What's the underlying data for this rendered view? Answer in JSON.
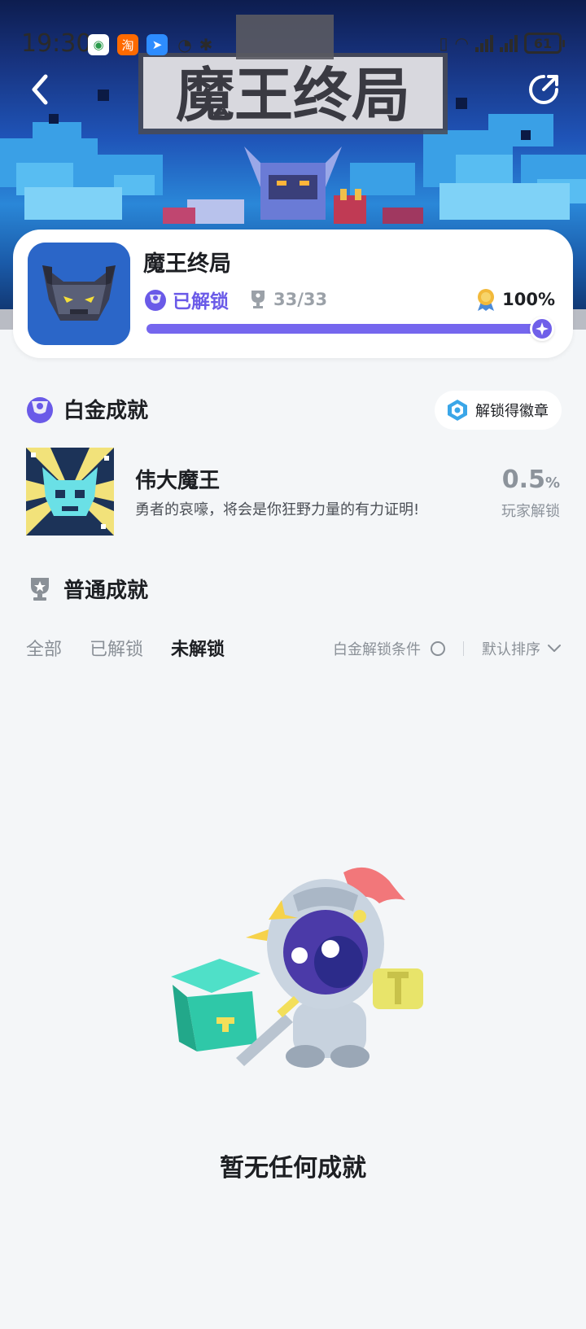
{
  "status_bar": {
    "time": "19:30",
    "apps": [
      "China Mobile",
      "淘",
      "Maps",
      "WeChat",
      "Bluetooth"
    ],
    "battery": "61"
  },
  "header": {
    "banner_title": "魔王终局",
    "back_icon": "chevron-left-icon",
    "share_icon": "share-icon"
  },
  "game": {
    "title": "魔王终局",
    "unlock_status": "已解锁",
    "trophy_count": "33/33",
    "completion": "100%",
    "progress": 1.0,
    "accent": "#7566ee"
  },
  "platinum": {
    "section_title": "白金成就",
    "badge_button": "解锁得徽章",
    "achievement": {
      "name": "伟大魔王",
      "description": "勇者的哀嚎，将会是你狂野力量的有力证明!",
      "rate_value": "0.5",
      "rate_unit": "%",
      "rate_label": "玩家解锁"
    }
  },
  "normal": {
    "section_title": "普通成就",
    "tabs": [
      {
        "label": "全部",
        "active": false
      },
      {
        "label": "已解锁",
        "active": false
      },
      {
        "label": "未解锁",
        "active": true
      }
    ],
    "platinum_condition": "白金解锁条件",
    "sort": "默认排序"
  },
  "empty_state": {
    "message": "暂无任何成就"
  }
}
